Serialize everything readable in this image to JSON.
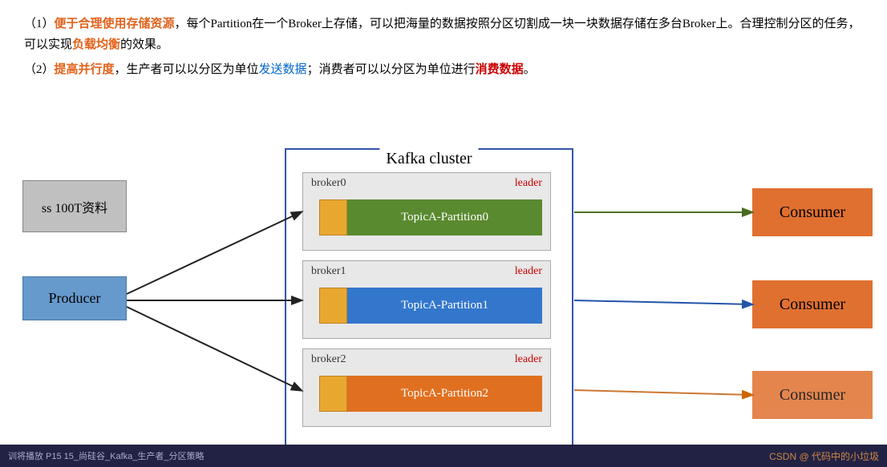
{
  "slide": {
    "text1": {
      "prefix": "（1）",
      "highlight1": "便于合理使用存储资源",
      "middle": "，每个Partition在一个Broker上存储，可以把海量的数据按照分区切割成一块一块数据存储在多台Broker上。合理控制分区的任务，可以实现",
      "highlight2": "负载均衡",
      "suffix": "的效果。"
    },
    "text2": {
      "prefix": "（2）",
      "highlight1": "提高并行度",
      "middle": "，生产者可以以分区为单位",
      "highlight2": "发送数据",
      "middle2": "；消费者可以以分区为单位进行",
      "highlight3": "消费数据",
      "suffix": "。"
    },
    "kafka_cluster_title": "Kafka cluster",
    "storage_label": "ss 100T资料",
    "producer_label": "Producer",
    "brokers": [
      {
        "id": "broker0",
        "leader": "leader",
        "partition": "TopicA-Partition0"
      },
      {
        "id": "broker1",
        "leader": "leader",
        "partition": "TopicA-Partition1"
      },
      {
        "id": "broker2",
        "leader": "leader",
        "partition": "TopicA-Partition2"
      }
    ],
    "consumers": [
      {
        "label": "Consumer"
      },
      {
        "label": "Consumer"
      },
      {
        "label": "Consumer"
      }
    ],
    "bottom_bar": {
      "left": "训将播放 P15 15_尚硅谷_Kafka_生产者_分区策略",
      "right": "CSDN @ 代码中的小垃圾"
    }
  }
}
